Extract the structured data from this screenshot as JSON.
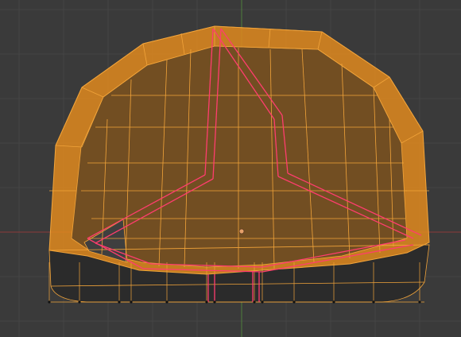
{
  "viewport": {
    "mode": "edit-mode",
    "view": "front-orthographic",
    "selection": "all-faces-selected",
    "colors": {
      "background": "#3a3a3a",
      "grid_line": "#444444",
      "axis_x": "#8c3a3a",
      "axis_z": "#4e7f3c",
      "face_fill": "#e08a1e",
      "edge": "#f2a43a",
      "seam": "#ff3d6e",
      "bottom_face": "#2a2a2a",
      "vertex": "#111111",
      "origin": "#e6a06a"
    }
  }
}
